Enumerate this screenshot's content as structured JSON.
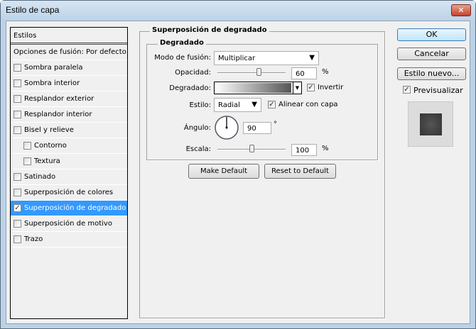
{
  "window": {
    "title": "Estilo de capa"
  },
  "styles_list": {
    "header": "Estilos",
    "blend_options": "Opciones de fusión: Por defecto",
    "items": [
      {
        "label": "Sombra paralela",
        "checked": false,
        "indent": false
      },
      {
        "label": "Sombra interior",
        "checked": false,
        "indent": false
      },
      {
        "label": "Resplandor exterior",
        "checked": false,
        "indent": false
      },
      {
        "label": "Resplandor interior",
        "checked": false,
        "indent": false
      },
      {
        "label": "Bisel y relieve",
        "checked": false,
        "indent": false
      },
      {
        "label": "Contorno",
        "checked": false,
        "indent": true
      },
      {
        "label": "Textura",
        "checked": false,
        "indent": true
      },
      {
        "label": "Satinado",
        "checked": false,
        "indent": false
      },
      {
        "label": "Superposición de colores",
        "checked": false,
        "indent": false
      },
      {
        "label": "Superposición de degradado",
        "checked": true,
        "indent": false,
        "selected": true
      },
      {
        "label": "Superposición de motivo",
        "checked": false,
        "indent": false
      },
      {
        "label": "Trazo",
        "checked": false,
        "indent": false
      }
    ]
  },
  "panel": {
    "title": "Superposición de degradado",
    "group": "Degradado",
    "blend_mode_label": "Modo de fusión:",
    "blend_mode": "Multiplicar",
    "opacity_label": "Opacidad:",
    "opacity": "60",
    "opacity_unit": "%",
    "gradient_label": "Degradado:",
    "invert_label": "Invertir",
    "invert": true,
    "style_label": "Estilo:",
    "style": "Radial",
    "align_label": "Alinear con capa",
    "align": true,
    "angle_label": "Ángulo:",
    "angle": "90",
    "angle_unit": "°",
    "scale_label": "Escala:",
    "scale": "100",
    "scale_unit": "%",
    "make_default": "Make Default",
    "reset_default": "Reset to Default"
  },
  "actions": {
    "ok": "OK",
    "cancel": "Cancelar",
    "new_style": "Estilo nuevo...",
    "preview_label": "Previsualizar",
    "preview": true
  }
}
